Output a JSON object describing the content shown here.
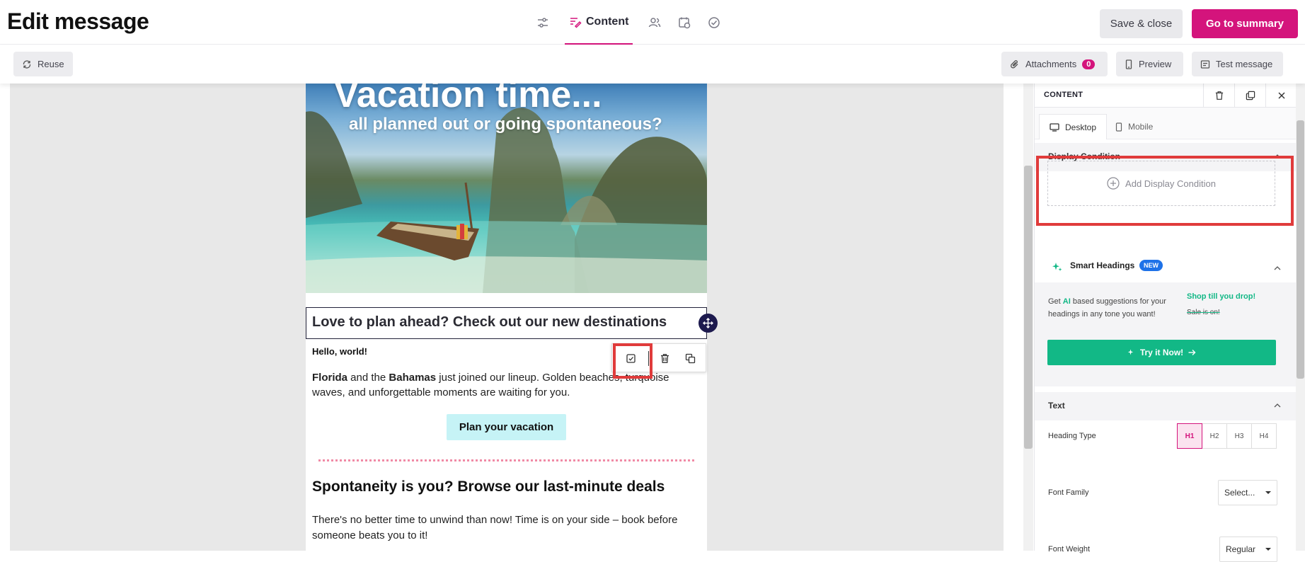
{
  "header": {
    "title": "Edit message",
    "active_step": "Content",
    "save_close": "Save & close",
    "summary": "Go to summary"
  },
  "toolbar": {
    "reuse": "Reuse",
    "attachments": "Attachments",
    "attachments_count": "0",
    "preview": "Preview",
    "test_message": "Test message"
  },
  "email": {
    "hero_title": "Vacation time...",
    "hero_subtitle": "all planned out or going spontaneous?",
    "heading1": "Love to plan ahead? Check out our new destinations",
    "greeting": "Hello, world!",
    "para1_b1": "Florida",
    "para1_t1": " and the ",
    "para1_b2": "Bahamas",
    "para1_t2": " just joined our lineup. Golden beaches, turquoise waves, and unforgettable moments are waiting for you.",
    "cta": "Plan your vacation",
    "heading2": "Spontaneity is you? Browse our last-minute deals",
    "para2": "There's no better time to unwind than now! Time is on your side – book before someone beats you to it!"
  },
  "panel": {
    "title": "CONTENT",
    "tab_desktop": "Desktop",
    "tab_mobile": "Mobile",
    "section_display": "Display Condition",
    "add_condition": "Add Display Condition",
    "smart_headings": "Smart Headings",
    "new_badge": "NEW",
    "sh_pre": "Get ",
    "sh_ai": "AI",
    "sh_post": " based suggestions for your headings in any tone you want!",
    "sh_ill1": "Shop till you drop!",
    "sh_ill2": "Sale is on!",
    "try_now": "Try it Now!",
    "section_text": "Text",
    "heading_type_label": "Heading Type",
    "heading_types": [
      "H1",
      "H2",
      "H3",
      "H4"
    ],
    "font_family_label": "Font Family",
    "font_family_value": "Select...",
    "font_weight_label": "Font Weight",
    "font_weight_value": "Regular"
  },
  "colors": {
    "brand_pink": "#d4147c",
    "teal": "#12b886",
    "highlight_red": "#e03b3b",
    "cta_bg": "#c6f3f6"
  }
}
